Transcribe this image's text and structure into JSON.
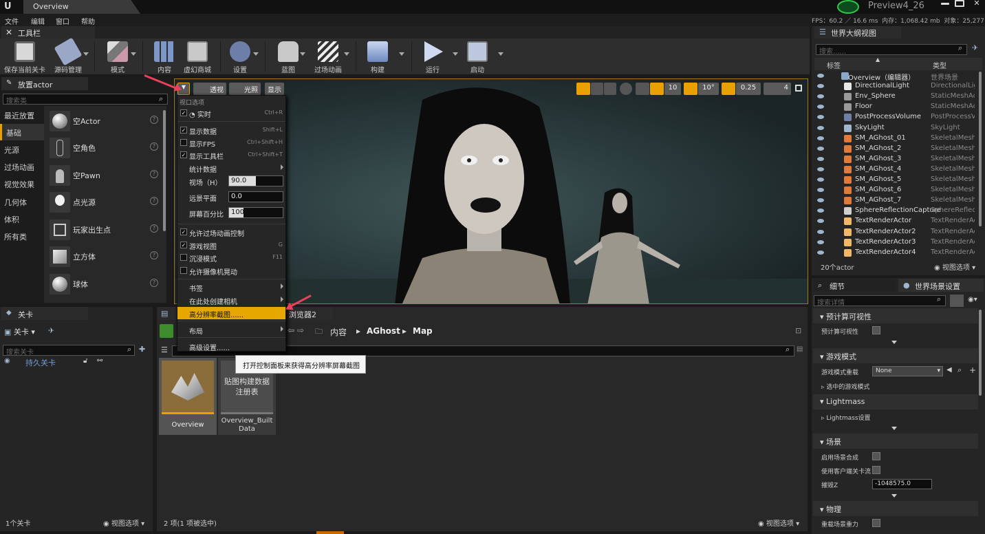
{
  "window": {
    "tab_title": "Overview",
    "project_name": "Preview4_26"
  },
  "menubar": {
    "items": [
      "文件",
      "编辑",
      "窗口",
      "帮助"
    ]
  },
  "stats": {
    "fps": "FPS：60.2 ／ 16.6 ms",
    "memory": "内存：1,068.42 mb",
    "objects": "对象：25,277"
  },
  "toolbar_panel": {
    "title": "工具栏"
  },
  "toolbar": {
    "buttons": [
      {
        "label": "保存当前关卡",
        "icon": "save-icon"
      },
      {
        "label": "源码管理",
        "icon": "source-control-icon"
      },
      {
        "label": "模式",
        "icon": "modes-icon"
      },
      {
        "label": "内容",
        "icon": "content-icon"
      },
      {
        "label": "虚幻商城",
        "icon": "marketplace-icon"
      },
      {
        "label": "设置",
        "icon": "settings-icon"
      },
      {
        "label": "蓝图",
        "icon": "blueprint-icon"
      },
      {
        "label": "过场动画",
        "icon": "cinematics-icon"
      },
      {
        "label": "构建",
        "icon": "build-icon"
      },
      {
        "label": "运行",
        "icon": "play-icon"
      },
      {
        "label": "启动",
        "icon": "launch-icon"
      }
    ]
  },
  "place_actor": {
    "title": "放置actor",
    "search_placeholder": "搜索类",
    "categories": [
      "最近放置",
      "基础",
      "光源",
      "过场动画",
      "视觉效果",
      "几何体",
      "体积",
      "所有类"
    ],
    "selected_category": "基础",
    "items": [
      "空Actor",
      "空角色",
      "空Pawn",
      "点光源",
      "玩家出生点",
      "立方体",
      "球体"
    ]
  },
  "viewport": {
    "perspective_label": "透视",
    "lit_label": "光照",
    "show_label": "显示",
    "grid_snap": "10",
    "rotation_snap": "10°",
    "scale_snap": "0.25",
    "camera_speed": "4"
  },
  "viewport_menu": {
    "header": "视口选项",
    "realtime": {
      "label": "实时",
      "shortcut": "Ctrl+R",
      "checked": true
    },
    "show_stats": {
      "label": "显示数据",
      "shortcut": "Shift+L",
      "checked": true
    },
    "show_fps": {
      "label": "显示FPS",
      "shortcut": "Ctrl+Shift+H",
      "checked": false
    },
    "show_toolbar": {
      "label": "显示工具栏",
      "shortcut": "Ctrl+Shift+T",
      "checked": true
    },
    "stats_submenu": "统计数据",
    "fov": {
      "label": "视场（H）",
      "value": "90.0",
      "fill": 0.5
    },
    "far_plane": {
      "label": "远景平面",
      "value": "0.0",
      "fill": 0.0
    },
    "screen_percentage": {
      "label": "屏幕百分比",
      "value": "100",
      "fill": 0.27
    },
    "allow_cinematic": {
      "label": "允许过场动画控制",
      "checked": true
    },
    "game_view": {
      "label": "游戏视图",
      "shortcut": "G",
      "checked": true
    },
    "immersive": {
      "label": "沉浸模式",
      "shortcut": "F11",
      "checked": false
    },
    "camera_shake": {
      "label": "允许摄像机晃动",
      "checked": false
    },
    "bookmarks": "书签",
    "create_camera": "在此处创建相机",
    "high_res_screenshot": "高分辨率截图......",
    "layout": "布局",
    "advanced": "高级设置......"
  },
  "tooltip": "打开控制面板来获得高分辨率屏幕截图",
  "levels": {
    "title": "关卡",
    "dropdown": "关卡",
    "search_placeholder": "搜索关卡",
    "persistent": "持久关卡",
    "count": "1个关卡",
    "view_options": "视图选项"
  },
  "content_browser": {
    "tab2": "浏览器2",
    "path": [
      "内容",
      "AGhost",
      "Map"
    ],
    "assets": [
      {
        "name": "Overview"
      },
      {
        "name": "Overview_BuiltData",
        "thumb_text": "贴图构建数据\n注册表"
      }
    ],
    "asset_name_line1": "Overview_Built",
    "asset_name_line2": "Data",
    "thumb_line1": "贴图构建数据",
    "thumb_line2": "注册表",
    "status": "2 项(1 项被选中)",
    "view_options": "视图选项"
  },
  "outliner": {
    "title": "世界大纲视图",
    "search_placeholder": "搜索......",
    "col_label": "标签",
    "col_type": "类型",
    "rows": [
      {
        "name": "Overview（编辑器）",
        "type": "世界场景"
      },
      {
        "name": "DirectionalLight",
        "type": "DirectionalLig"
      },
      {
        "name": "Env_Sphere",
        "type": "StaticMeshAc"
      },
      {
        "name": "Floor",
        "type": "StaticMeshAc"
      },
      {
        "name": "PostProcessVolume",
        "type": "PostProcessV"
      },
      {
        "name": "SkyLight",
        "type": "SkyLight"
      },
      {
        "name": "SM_AGhost_01",
        "type": "SkeletalMesh."
      },
      {
        "name": "SM_AGhost_2",
        "type": "SkeletalMesh."
      },
      {
        "name": "SM_AGhost_3",
        "type": "SkeletalMesh."
      },
      {
        "name": "SM_AGhost_4",
        "type": "SkeletalMesh."
      },
      {
        "name": "SM_AGhost_5",
        "type": "SkeletalMesh."
      },
      {
        "name": "SM_AGhost_6",
        "type": "SkeletalMesh."
      },
      {
        "name": "SM_AGhost_7",
        "type": "SkeletalMesh."
      },
      {
        "name": "SphereReflectionCapture",
        "type": "SphereReflect"
      },
      {
        "name": "TextRenderActor",
        "type": "TextRenderAc"
      },
      {
        "name": "TextRenderActor2",
        "type": "TextRenderAc"
      },
      {
        "name": "TextRenderActor3",
        "type": "TextRenderAc"
      },
      {
        "name": "TextRenderActor4",
        "type": "TextRenderAc"
      }
    ],
    "count": "20个actor",
    "view_options": "视图选项"
  },
  "details": {
    "tab_details": "细节",
    "tab_world": "世界场景设置",
    "search_placeholder": "搜索详情",
    "sec_precomputed": "预计算可视性",
    "precomputed_row": "预计算可视性",
    "sec_game_mode": "游戏模式",
    "game_mode_override": "游戏模式重载",
    "game_mode_value": "None",
    "selected_game_mode": "选中的游戏模式",
    "sec_lightmass": "Lightmass",
    "lightmass_settings": "Lightmass设置",
    "sec_world": "场景",
    "enable_world_composition": "启用场景合成",
    "use_client_streaming": "使用客户端关卡流",
    "kill_z": "摧毁Z",
    "kill_z_value": "-1048575.0",
    "sec_physics": "物理",
    "override_gravity": "重载场景重力"
  },
  "colors": {
    "accent": "#e8a100",
    "selected": "#d49c00",
    "highlight_row": "#e6a800"
  }
}
